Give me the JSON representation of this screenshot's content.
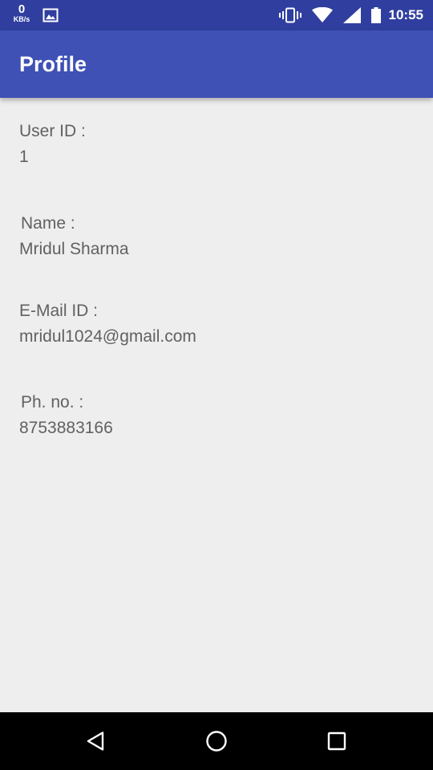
{
  "status_bar": {
    "data_rate_value": "0",
    "data_rate_unit": "KB/s",
    "time": "10:55",
    "icons": [
      "image-notification-icon",
      "vibrate-icon",
      "wifi-icon",
      "signal-icon",
      "battery-icon"
    ]
  },
  "app_bar": {
    "title": "Profile",
    "color": "#3f51b5"
  },
  "profile": {
    "user_id_label": "User ID :",
    "user_id_value": "1",
    "name_label": "Name :",
    "name_value": "Mridul Sharma",
    "email_label": "E-Mail ID :",
    "email_value": "mridul1024@gmail.com",
    "phone_label": "Ph. no. :",
    "phone_value": "8753883166"
  },
  "nav_bar": {
    "icons": [
      "back-icon",
      "home-icon",
      "recents-icon"
    ]
  }
}
